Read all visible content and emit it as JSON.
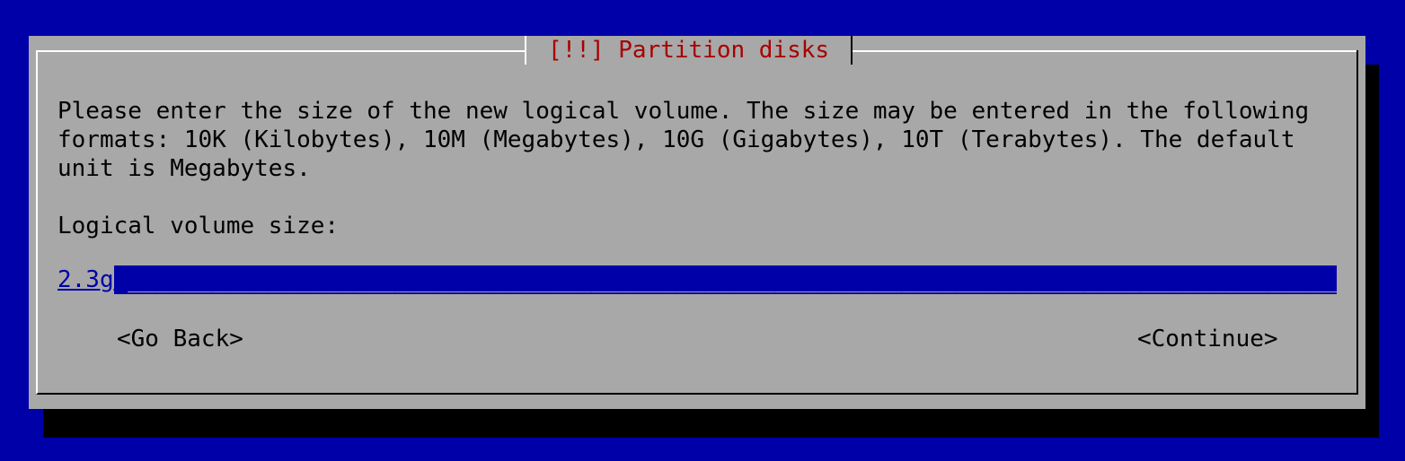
{
  "dialog": {
    "title": "[!!] Partition disks",
    "description": "Please enter the size of the new logical volume. The size may be entered in the following formats: 10K (Kilobytes), 10M (Megabytes), 10G (Gigabytes), 10T (Terabytes). The default unit is Megabytes.",
    "field_label": "Logical volume size:",
    "field_value": "2.3g",
    "buttons": {
      "back": "<Go Back>",
      "continue": "<Continue>"
    }
  },
  "colors": {
    "background": "#0000a8",
    "dialog": "#a8a8a8",
    "title": "#a80000",
    "shadow": "#000000"
  }
}
